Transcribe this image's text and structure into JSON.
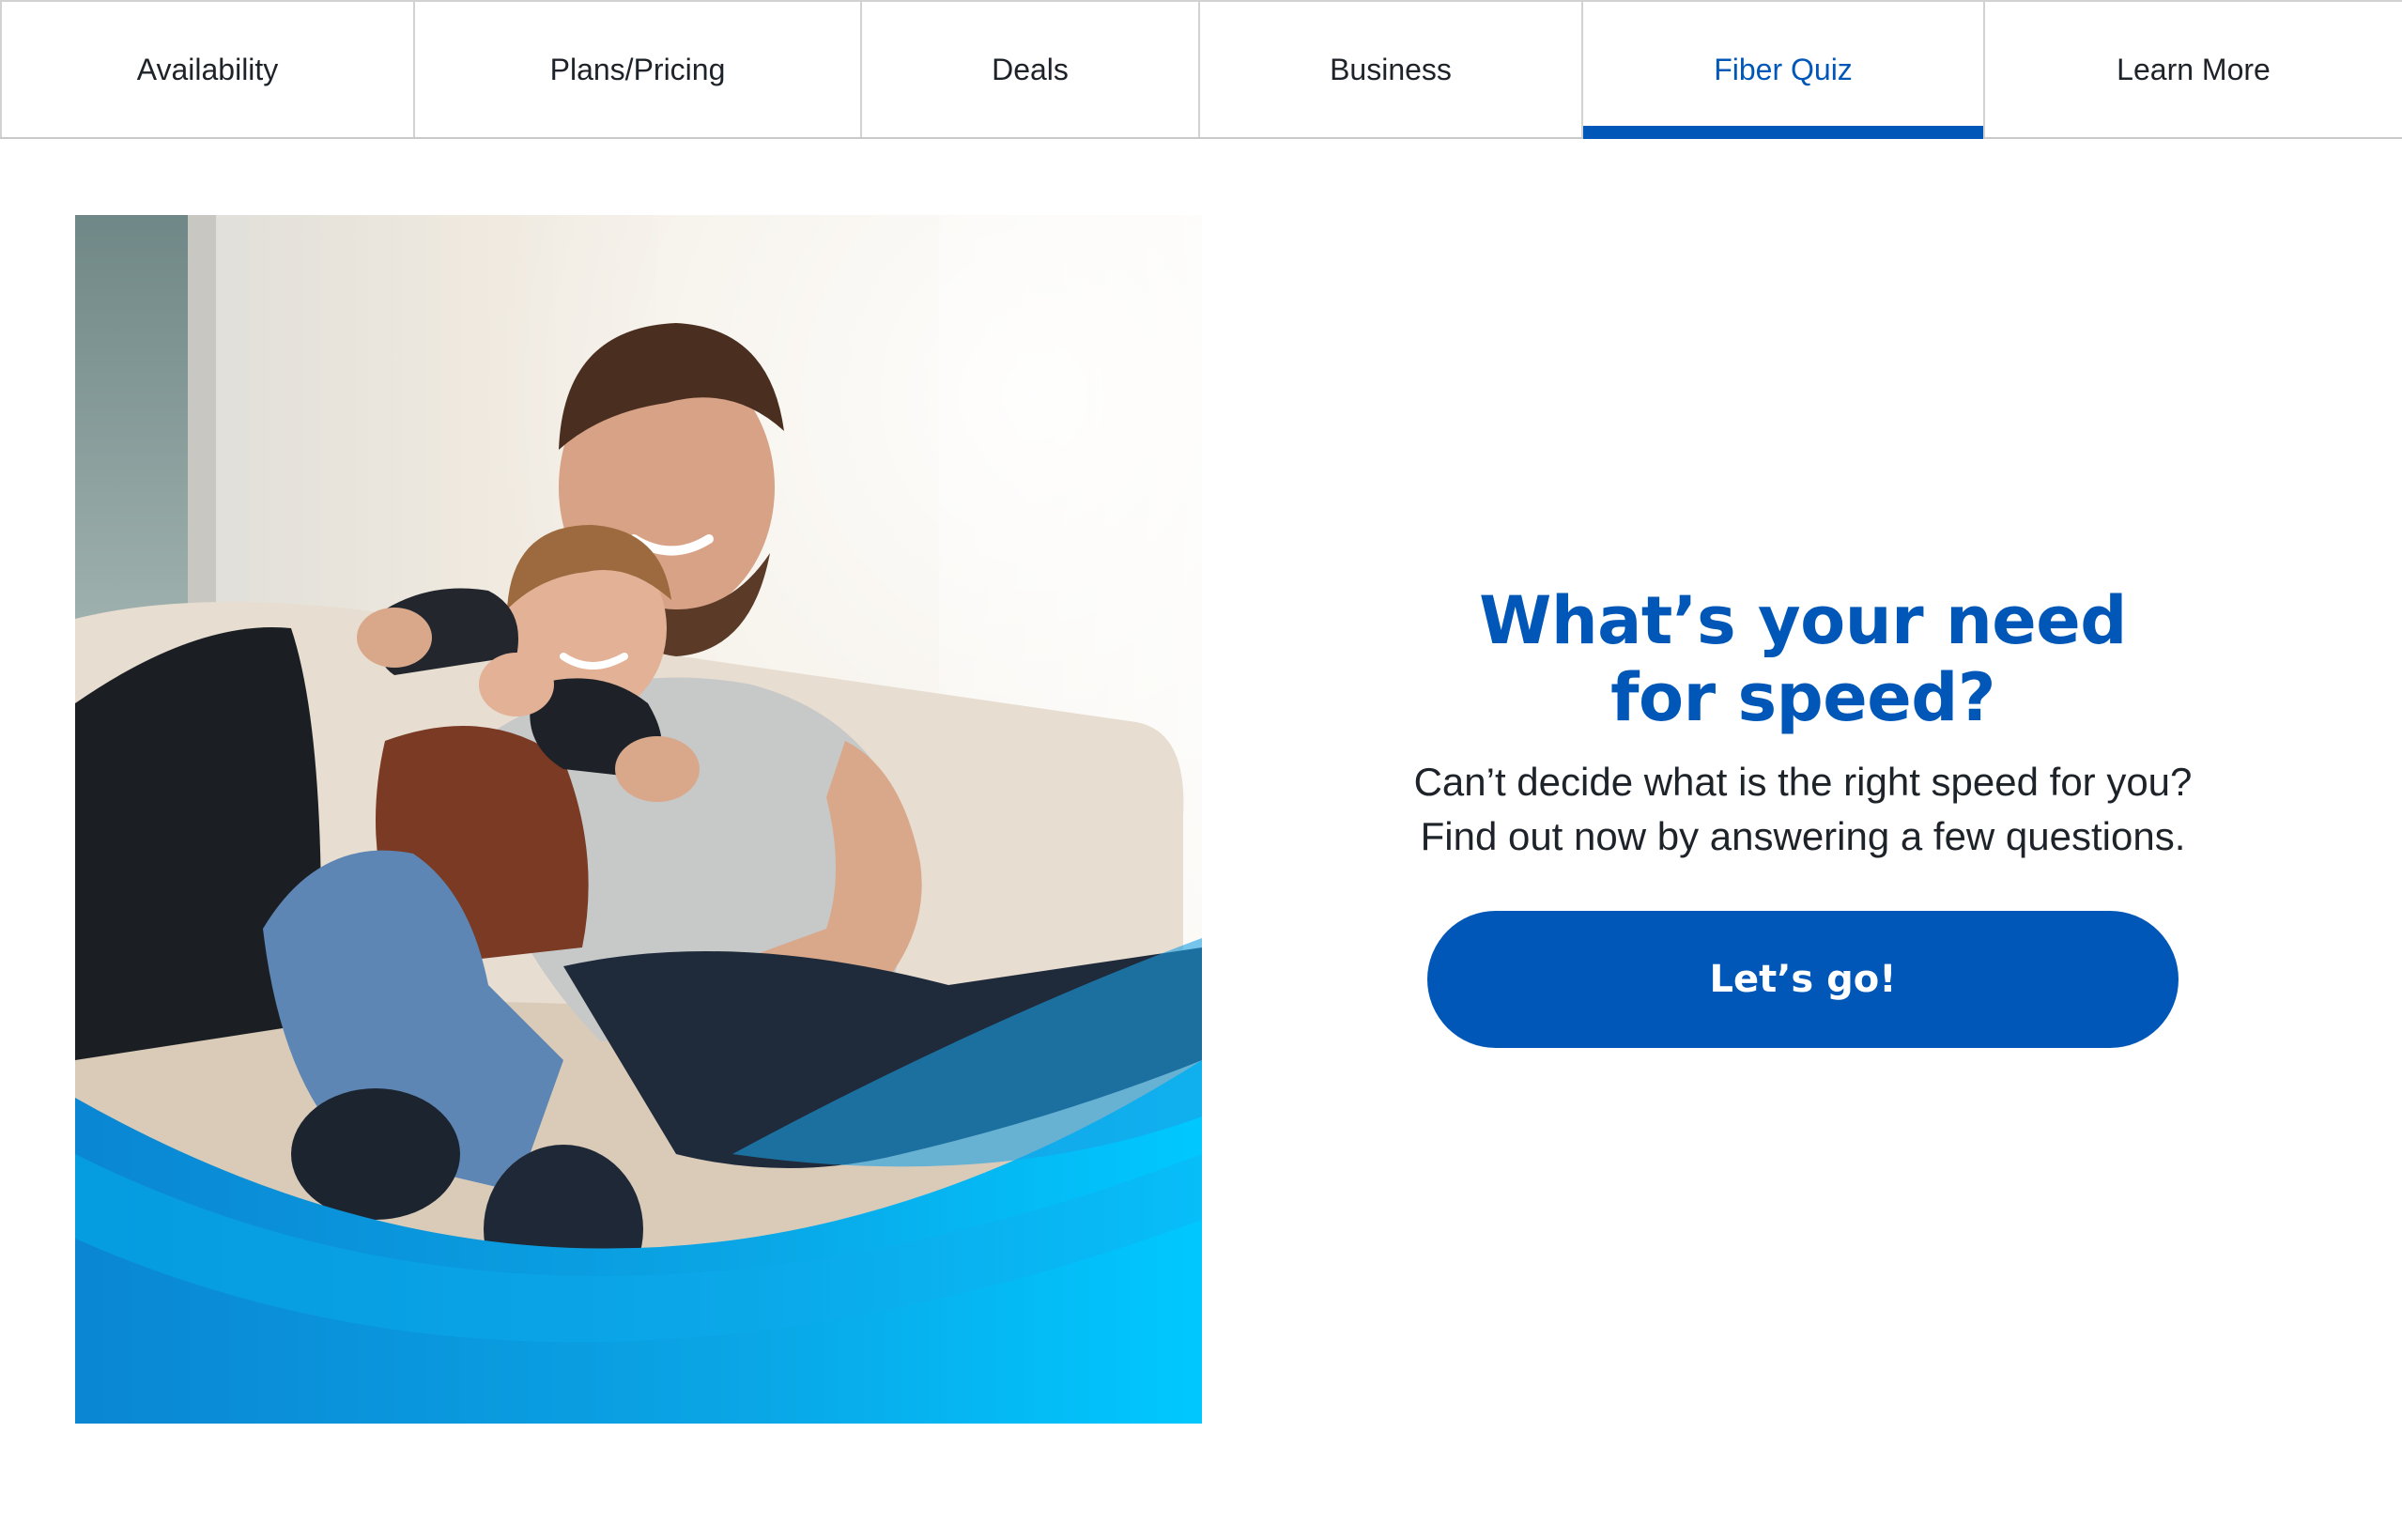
{
  "tabs": [
    {
      "label": "Availability",
      "active": false
    },
    {
      "label": "Plans/Pricing",
      "active": false
    },
    {
      "label": "Deals",
      "active": false
    },
    {
      "label": "Business",
      "active": false
    },
    {
      "label": "Fiber Quiz",
      "active": true
    },
    {
      "label": "Learn More",
      "active": false
    }
  ],
  "hero": {
    "image": "father-and-son-playing-video-games-photo"
  },
  "quiz": {
    "headline_line1": "What’s your need",
    "headline_line2": "for speed?",
    "sub_line1": "Can’t decide what is the right speed for you?",
    "sub_line2": "Find out now by answering a few questions.",
    "cta_label": "Let’s go!"
  },
  "colors": {
    "brand_blue": "#0057b8",
    "wave_light": "#00c8ff",
    "wave_mid": "#0096e0",
    "text": "#1d2329"
  }
}
